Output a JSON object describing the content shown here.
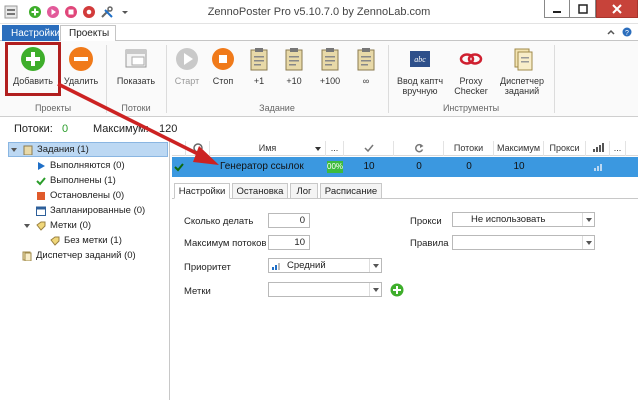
{
  "window": {
    "title": "ZennoPoster Pro v5.10.7.0 by ZennoLab.com"
  },
  "ribbon_tabs": [
    {
      "label": "Настройки"
    },
    {
      "label": "Проекты"
    }
  ],
  "ribbon": {
    "buttons": {
      "add": "Добавить",
      "delete": "Удалить",
      "show": "Показать",
      "start": "Старт",
      "stop": "Стоп",
      "plus1": "+1",
      "plus10": "+10",
      "plus100": "+100",
      "infinity": "∞",
      "captcha": "Ввод каптч вручную",
      "proxy": "Proxy Checker",
      "scheduler": "Диспетчер заданий"
    },
    "groups": {
      "projects": "Проекты",
      "threads": "Потоки",
      "task": "Задание",
      "tools": "Инструменты"
    }
  },
  "stats": {
    "threads_label": "Потоки:",
    "threads_value": "0",
    "max_label": "Максимум:",
    "max_value": "120"
  },
  "tree": {
    "tasks": "Задания (1)",
    "running": "Выполняются (0)",
    "done": "Выполнены (1)",
    "stopped": "Остановлены (0)",
    "scheduled": "Запланированные (0)",
    "tags": "Метки (0)",
    "no_tag": "Без метки (1)",
    "dispatcher": "Диспетчер заданий (0)"
  },
  "grid": {
    "headers": {
      "name": "Имя",
      "ellipsis": "...",
      "threads": "Потоки",
      "max": "Максимум",
      "proxy": "Прокси"
    },
    "row": {
      "name": "Генератор ссылок",
      "progress": "00%",
      "done": "10",
      "redo": "0",
      "threads": "0",
      "max": "10",
      "progress_value": 0
    }
  },
  "subtabs": [
    "Настройки",
    "Остановка",
    "Лог",
    "Расписание"
  ],
  "form": {
    "how_many_label": "Сколько делать",
    "how_many_value": "0",
    "max_threads_label": "Максимум потоков",
    "max_threads_value": "10",
    "priority_label": "Приоритет",
    "priority_value": "Средний",
    "tags_label": "Метки",
    "tags_value": "",
    "proxy_label": "Прокси",
    "proxy_value": "Не использовать",
    "rules_label": "Правила",
    "rules_value": ""
  },
  "colors": {
    "accent_blue": "#2b6ebd",
    "selected_row": "#3b98e0",
    "arrow_red": "#cc2222",
    "add_green": "#3eae2b",
    "stop_orange": "#f07a1a",
    "threads_green": "#2a9d2a"
  }
}
